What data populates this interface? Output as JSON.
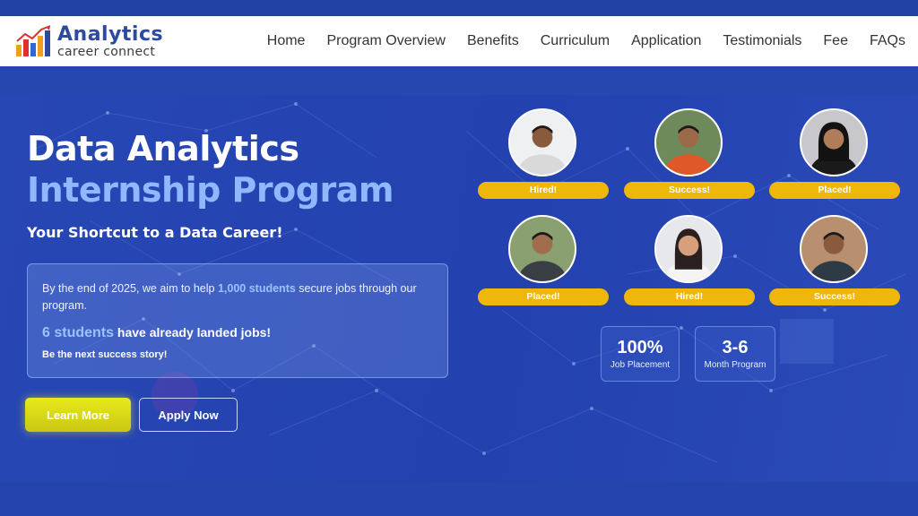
{
  "brand": {
    "title": "Analytics",
    "subtitle": "career connect"
  },
  "nav": {
    "items": [
      "Home",
      "Program Overview",
      "Benefits",
      "Curriculum",
      "Application",
      "Testimonials",
      "Fee",
      "FAQs"
    ]
  },
  "hero": {
    "title_line1": "Data Analytics",
    "title_line2": "Internship Program",
    "tagline": "Your Shortcut to a Data Career!",
    "info": {
      "text_before": "By the end of 2025, we aim to help ",
      "highlight_goal": "1,000 students",
      "text_after": " secure jobs through our program.",
      "landed_count": "6 students",
      "landed_text": " have already landed jobs!",
      "cta_text": "Be the next success story!"
    },
    "buttons": {
      "learn_more": "Learn More",
      "apply_now": "Apply Now"
    }
  },
  "students": [
    {
      "badge": "Hired!"
    },
    {
      "badge": "Success!"
    },
    {
      "badge": "Placed!"
    },
    {
      "badge": "Placed!"
    },
    {
      "badge": "Hired!"
    },
    {
      "badge": "Success!"
    }
  ],
  "stats": [
    {
      "value": "100%",
      "label": "Job Placement"
    },
    {
      "value": "3-6",
      "label": "Month Program"
    }
  ],
  "colors": {
    "hero_bg": "#2342b0",
    "accent_light_blue": "#8fb8ff",
    "badge_yellow": "#f0b70b",
    "learn_button": "#e8ea1c",
    "brand_blue": "#2c4aa0"
  }
}
